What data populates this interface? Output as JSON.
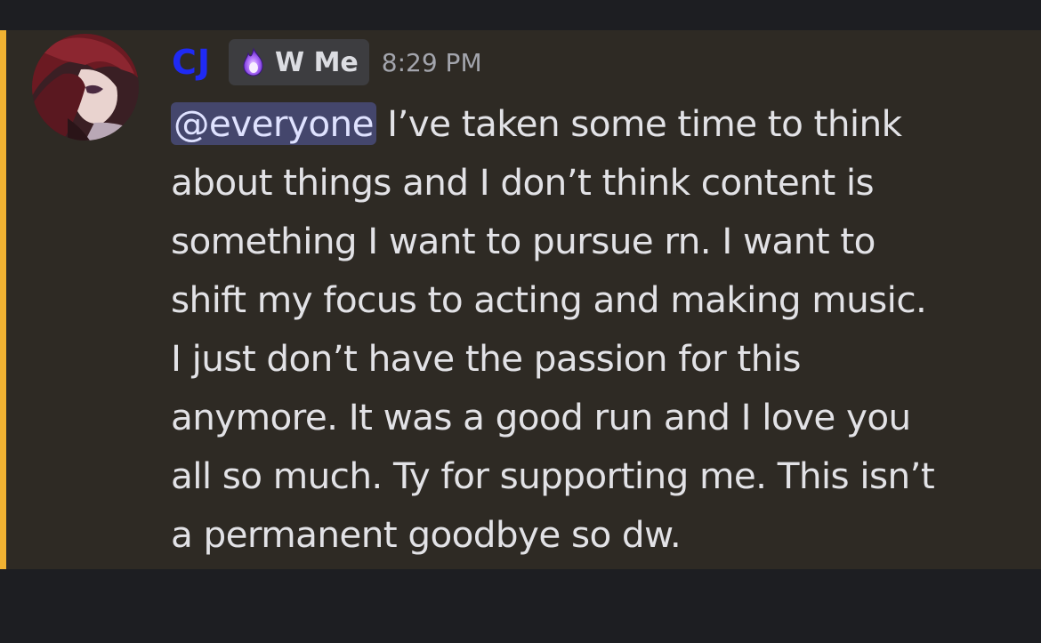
{
  "message": {
    "author": {
      "name": "CJ",
      "name_color": "#1f2af4",
      "avatar": "avatar-image"
    },
    "role_tag": {
      "icon": "purple-flame-icon",
      "label": "W Me"
    },
    "timestamp": "8:29 PM",
    "mention": "@everyone",
    "lines": [
      " I’ve taken some time to think",
      "about things and I don’t think content is",
      "something I want to pursue rn. I want to",
      "shift my focus to acting and making music.",
      "I just don’t have the passion for this",
      "anymore. It was a good run and I love you",
      "all so much. Ty for supporting me. This isn’t",
      "a permanent goodbye so dw."
    ],
    "highlight_color": "#f0b232"
  }
}
